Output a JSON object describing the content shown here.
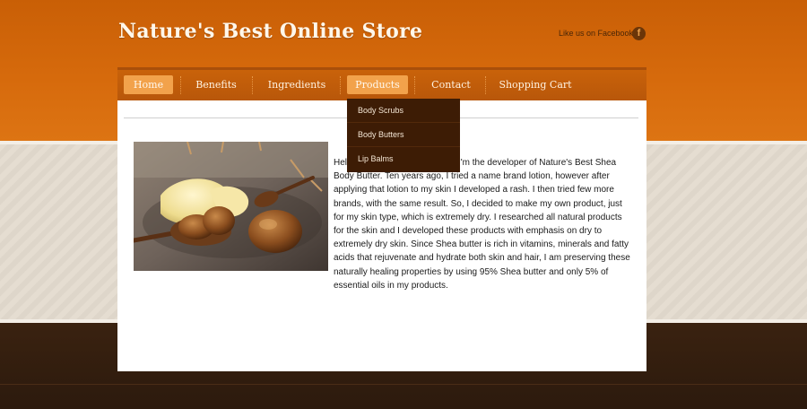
{
  "header": {
    "site_title": "Nature's Best Online Store",
    "facebook_text": "Like us on Facebook",
    "facebook_icon": "facebook-icon",
    "facebook_glyph": "f"
  },
  "nav": {
    "items": [
      {
        "label": "Home",
        "active": true
      },
      {
        "label": "Benefits",
        "active": false
      },
      {
        "label": "Ingredients",
        "active": false
      },
      {
        "label": "Products",
        "active": true
      },
      {
        "label": "Contact",
        "active": false
      },
      {
        "label": "Shopping Cart",
        "active": false
      }
    ]
  },
  "dropdown": {
    "items": [
      "Body Scrubs",
      "Body Butters",
      "Lip Balms"
    ]
  },
  "main": {
    "image_alt": "shea butter with wooden spoons and shea nuts",
    "intro": "Hello, my name is Pat Leggett. I'm the developer of Nature's Best Shea Body Butter. Ten years ago, I tried a name brand lotion, however after applying that lotion to my skin I developed a rash. I then tried few more brands, with the same result. So, I decided to make my own product, just for my skin type, which is extremely dry. I researched all natural products for the skin and I developed these products with emphasis on dry to extremely dry skin.  Since Shea butter is rich in vitamins, minerals and fatty acids that rejuvenate and hydrate both skin and hair, I am preserving these naturally healing properties by using 95% Shea butter  and only 5% of essential oils in my products."
  },
  "colors": {
    "header_orange": "#d66a0c",
    "nav_active": "#f2a24b",
    "dropdown_bg": "#3d1c05",
    "footer_dark": "#2c1a0e"
  }
}
